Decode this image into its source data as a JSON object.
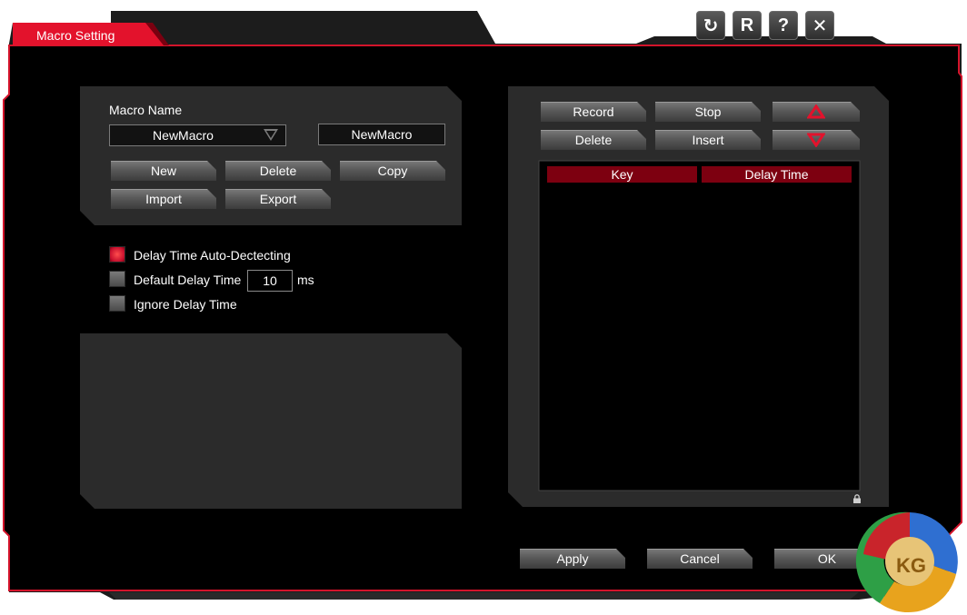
{
  "window": {
    "title": "Macro Setting",
    "controls": [
      {
        "name": "refresh-icon",
        "glyph": "↻"
      },
      {
        "name": "reset-icon",
        "glyph": "R"
      },
      {
        "name": "help-icon",
        "glyph": "?"
      },
      {
        "name": "close-icon",
        "glyph": "✕"
      }
    ]
  },
  "macro": {
    "name_label": "Macro Name",
    "selected_macro": "NewMacro",
    "name_value": "NewMacro",
    "buttons": {
      "new": "New",
      "delete": "Delete",
      "copy": "Copy",
      "import": "Import",
      "export": "Export"
    }
  },
  "delay": {
    "auto_detect_label": "Delay Time Auto-Dectecting",
    "auto_detect_checked": true,
    "default_label": "Default Delay Time",
    "default_checked": false,
    "default_value": "10",
    "unit": "ms",
    "ignore_label": "Ignore Delay Time",
    "ignore_checked": false
  },
  "recorder": {
    "record": "Record",
    "stop": "Stop",
    "delete": "Delete",
    "insert": "Insert",
    "columns": [
      "Key",
      "Delay Time"
    ],
    "rows": []
  },
  "footer": {
    "apply": "Apply",
    "cancel": "Cancel",
    "ok": "OK"
  },
  "colors": {
    "accent": "#e3122c",
    "panel": "#2b2b2b",
    "background": "#000000",
    "table_header": "#7d0010"
  }
}
